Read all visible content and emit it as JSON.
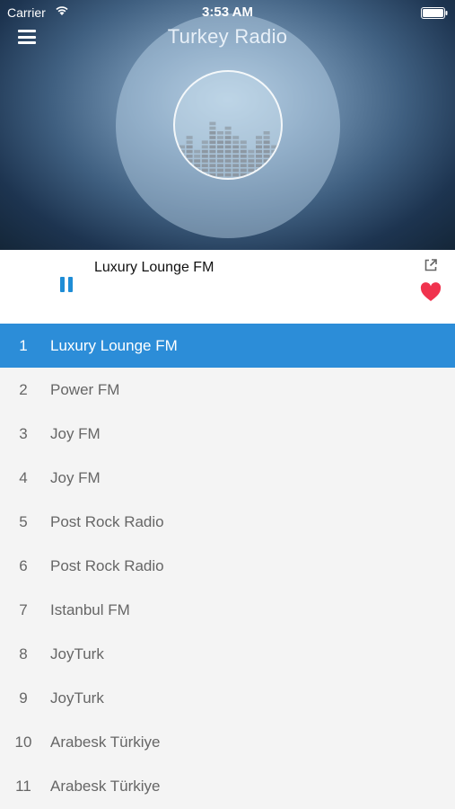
{
  "status_bar": {
    "carrier": "Carrier",
    "time": "3:53 AM"
  },
  "header": {
    "title": "Turkey Radio",
    "menu_icon": "hamburger-menu-icon"
  },
  "player": {
    "now_playing": "Luxury Lounge FM",
    "state": "playing",
    "pause_icon": "pause-icon",
    "share_icon": "external-link-icon",
    "favorite_icon": "heart-icon",
    "favorite_color": "#f0334e",
    "accent_color": "#1f8dd6"
  },
  "stations": [
    {
      "num": "1",
      "name": "Luxury Lounge FM",
      "active": true
    },
    {
      "num": "2",
      "name": "Power FM"
    },
    {
      "num": "3",
      "name": "Joy FM"
    },
    {
      "num": "4",
      "name": "Joy FM"
    },
    {
      "num": "5",
      "name": "Post Rock Radio"
    },
    {
      "num": "6",
      "name": "Post Rock Radio"
    },
    {
      "num": "7",
      "name": "Istanbul FM"
    },
    {
      "num": "8",
      "name": "JoyTurk"
    },
    {
      "num": "9",
      "name": "JoyTurk"
    },
    {
      "num": "10",
      "name": "Arabesk Türkiye"
    },
    {
      "num": "11",
      "name": "Arabesk Türkiye"
    }
  ],
  "selected_color": "#2c8dd8"
}
